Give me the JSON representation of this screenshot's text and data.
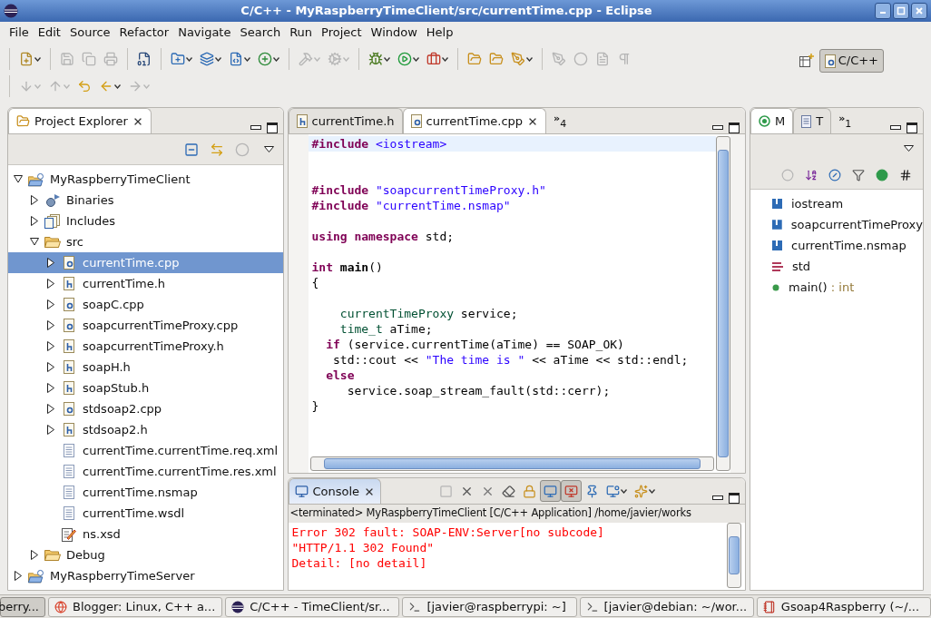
{
  "window": {
    "title": "C/C++ - MyRaspberryTimeClient/src/currentTime.cpp - Eclipse"
  },
  "menu": [
    "File",
    "Edit",
    "Source",
    "Refactor",
    "Navigate",
    "Search",
    "Run",
    "Project",
    "Window",
    "Help"
  ],
  "toolbar": {
    "rows": [
      [
        [
          {
            "kind": "new",
            "disabled": false,
            "dropdown": true
          }
        ],
        [
          {
            "kind": "save",
            "disabled": true,
            "dropdown": false
          },
          {
            "kind": "save-all",
            "disabled": true,
            "dropdown": false
          },
          {
            "kind": "print",
            "disabled": true,
            "dropdown": false
          }
        ],
        [
          {
            "kind": "binary",
            "disabled": false,
            "dropdown": false
          }
        ],
        [
          {
            "kind": "new-project",
            "disabled": false,
            "dropdown": true
          },
          {
            "kind": "new-folder",
            "disabled": false,
            "dropdown": true
          },
          {
            "kind": "new-class",
            "disabled": false,
            "dropdown": true
          },
          {
            "kind": "new-other",
            "disabled": false,
            "dropdown": true
          }
        ],
        [
          {
            "kind": "build",
            "disabled": true,
            "dropdown": true
          },
          {
            "kind": "build-all",
            "disabled": true,
            "dropdown": true
          }
        ],
        [
          {
            "kind": "debug",
            "disabled": false,
            "dropdown": true
          },
          {
            "kind": "run",
            "disabled": false,
            "dropdown": true
          },
          {
            "kind": "external",
            "disabled": false,
            "dropdown": true
          }
        ],
        [
          {
            "kind": "open-type",
            "disabled": false,
            "dropdown": false
          },
          {
            "kind": "open-element",
            "disabled": false,
            "dropdown": false
          },
          {
            "kind": "pen",
            "disabled": false,
            "dropdown": true
          }
        ],
        [
          {
            "kind": "pen",
            "disabled": true,
            "dropdown": false
          },
          {
            "kind": "dots",
            "disabled": true,
            "dropdown": false
          },
          {
            "kind": "page",
            "disabled": true,
            "dropdown": false
          },
          {
            "kind": "pilcrow",
            "disabled": true,
            "dropdown": false
          }
        ]
      ],
      [
        [
          {
            "kind": "next-annotation",
            "disabled": true,
            "dropdown": true
          },
          {
            "kind": "prev-annotation",
            "disabled": true,
            "dropdown": true
          },
          {
            "kind": "last-edit",
            "disabled": false,
            "dropdown": false
          },
          {
            "kind": "back",
            "disabled": false,
            "dropdown": true
          },
          {
            "kind": "forward",
            "disabled": true,
            "dropdown": true
          }
        ]
      ]
    ]
  },
  "perspectives": [
    {
      "label": "C/C++",
      "selected": true
    }
  ],
  "explorer": {
    "title": "Project Explorer",
    "actions": [
      {
        "kind": "collapse",
        "disabled": false
      },
      {
        "kind": "link",
        "disabled": false
      },
      {
        "kind": "dots",
        "disabled": true
      }
    ],
    "tree": [
      {
        "label": "MyRaspberryTimeClient",
        "kind": "project",
        "expanded": true,
        "selected": false,
        "children": [
          {
            "label": "Binaries",
            "kind": "binaries",
            "expanded": false,
            "selected": false
          },
          {
            "label": "Includes",
            "kind": "includes",
            "expanded": false,
            "selected": false
          },
          {
            "label": "src",
            "kind": "folder",
            "expanded": true,
            "selected": false,
            "children": [
              {
                "label": "currentTime.cpp",
                "kind": "c-source",
                "expanded": false,
                "selected": true
              },
              {
                "label": "currentTime.h",
                "kind": "header",
                "expanded": false,
                "selected": false
              },
              {
                "label": "soapC.cpp",
                "kind": "c-source",
                "expanded": false,
                "selected": false
              },
              {
                "label": "soapcurrentTimeProxy.cpp",
                "kind": "c-source",
                "expanded": false,
                "selected": false
              },
              {
                "label": "soapcurrentTimeProxy.h",
                "kind": "header",
                "expanded": false,
                "selected": false
              },
              {
                "label": "soapH.h",
                "kind": "header",
                "expanded": false,
                "selected": false
              },
              {
                "label": "soapStub.h",
                "kind": "header",
                "expanded": false,
                "selected": false
              },
              {
                "label": "stdsoap2.cpp",
                "kind": "c-source",
                "expanded": false,
                "selected": false
              },
              {
                "label": "stdsoap2.h",
                "kind": "header",
                "expanded": false,
                "selected": false
              },
              {
                "label": "currentTime.currentTime.req.xml",
                "kind": "text",
                "selected": false
              },
              {
                "label": "currentTime.currentTime.res.xml",
                "kind": "text",
                "selected": false
              },
              {
                "label": "currentTime.nsmap",
                "kind": "text",
                "selected": false
              },
              {
                "label": "currentTime.wsdl",
                "kind": "text",
                "selected": false
              },
              {
                "label": "ns.xsd",
                "kind": "xsd",
                "selected": false
              }
            ]
          },
          {
            "label": "Debug",
            "kind": "folder",
            "expanded": false,
            "selected": false
          }
        ]
      },
      {
        "label": "MyRaspberryTimeServer",
        "kind": "project",
        "expanded": false,
        "selected": false
      }
    ]
  },
  "editor": {
    "tabs": [
      {
        "label": "currentTime.h",
        "kind": "header",
        "selected": false
      },
      {
        "label": "currentTime.cpp",
        "kind": "c-source",
        "selected": true
      }
    ],
    "overflow": {
      "chevron": "»",
      "count": "4"
    },
    "lines": [
      {
        "current": true,
        "tokens": [
          {
            "kind": "directive",
            "text": "#include "
          },
          {
            "kind": "string",
            "text": "<iostream>"
          }
        ]
      },
      {
        "current": false
      },
      {
        "current": false
      },
      {
        "current": false,
        "tokens": [
          {
            "kind": "directive",
            "text": "#include "
          },
          {
            "kind": "string",
            "text": "\"soapcurrentTimeProxy.h\""
          }
        ]
      },
      {
        "current": false,
        "tokens": [
          {
            "kind": "directive",
            "text": "#include "
          },
          {
            "kind": "string",
            "text": "\"currentTime.nsmap\""
          }
        ]
      },
      {
        "current": false
      },
      {
        "current": false,
        "tokens": [
          {
            "kind": "keyword",
            "text": "using namespace"
          },
          {
            "kind": "plain",
            "text": " std;"
          }
        ]
      },
      {
        "current": false
      },
      {
        "current": false,
        "tokens": [
          {
            "kind": "keyword",
            "text": "int "
          },
          {
            "kind": "function",
            "text": "main"
          },
          {
            "kind": "plain",
            "text": "()"
          }
        ]
      },
      {
        "current": false,
        "tokens": [
          {
            "kind": "plain",
            "text": "{"
          }
        ]
      },
      {
        "current": false
      },
      {
        "current": false,
        "tokens": [
          {
            "kind": "type",
            "text": "    currentTimeProxy"
          },
          {
            "kind": "plain",
            "text": " service;"
          }
        ]
      },
      {
        "current": false,
        "tokens": [
          {
            "kind": "type",
            "text": "    time_t"
          },
          {
            "kind": "plain",
            "text": " aTime;"
          }
        ]
      },
      {
        "current": false,
        "tokens": [
          {
            "kind": "keyword",
            "text": "  if"
          },
          {
            "kind": "plain",
            "text": " (service.currentTime(aTime) == SOAP_OK)"
          }
        ]
      },
      {
        "current": false,
        "tokens": [
          {
            "kind": "plain",
            "text": "   std::cout << "
          },
          {
            "kind": "string",
            "text": "\"The time is \""
          },
          {
            "kind": "plain",
            "text": " << aTime << std::endl;"
          }
        ]
      },
      {
        "current": false,
        "tokens": [
          {
            "kind": "keyword",
            "text": "  else"
          }
        ]
      },
      {
        "current": false,
        "tokens": [
          {
            "kind": "plain",
            "text": "     service.soap_stream_fault(std::cerr);"
          }
        ]
      },
      {
        "current": false,
        "tokens": [
          {
            "kind": "plain",
            "text": "}"
          }
        ]
      }
    ]
  },
  "outline": {
    "tabs": [
      {
        "label": "M",
        "kind": "outline",
        "selected": true
      },
      {
        "label": "T",
        "kind": "tasks",
        "selected": false
      }
    ],
    "overflow": {
      "chevron": "»",
      "count": "1"
    },
    "actions": [
      {
        "kind": "dots",
        "disabled": true
      },
      {
        "kind": "sort",
        "disabled": false
      },
      {
        "kind": "hide-fields",
        "disabled": false
      },
      {
        "kind": "hide-static",
        "disabled": false
      },
      {
        "kind": "hide-nonpublic",
        "disabled": false
      },
      {
        "kind": "hash",
        "disabled": false
      }
    ],
    "items": [
      {
        "kind": "include",
        "label": "iostream"
      },
      {
        "kind": "include",
        "label": "soapcurrentTimeProxy"
      },
      {
        "kind": "include",
        "label": "currentTime.nsmap"
      },
      {
        "kind": "namespace",
        "label": "std"
      },
      {
        "kind": "function",
        "label": "main()",
        "return_type": ": int"
      }
    ]
  },
  "console": {
    "title": "Console",
    "actions": [
      {
        "kind": "stop",
        "disabled": true,
        "pressed": false,
        "dropdown": false
      },
      {
        "kind": "remove",
        "disabled": false,
        "pressed": false,
        "dropdown": false
      },
      {
        "kind": "remove-all",
        "disabled": false,
        "pressed": false,
        "dropdown": false
      },
      {
        "kind": "clear",
        "disabled": false,
        "pressed": false,
        "dropdown": false
      },
      {
        "kind": "scroll-lock",
        "disabled": false,
        "pressed": false,
        "dropdown": false
      },
      {
        "kind": "stdout",
        "disabled": false,
        "pressed": true,
        "dropdown": false
      },
      {
        "kind": "stderr",
        "disabled": false,
        "pressed": true,
        "dropdown": false
      },
      {
        "kind": "pin",
        "disabled": false,
        "pressed": false,
        "dropdown": false
      },
      {
        "kind": "display",
        "disabled": false,
        "pressed": false,
        "dropdown": true
      },
      {
        "kind": "open-console",
        "disabled": false,
        "pressed": false,
        "dropdown": true
      }
    ],
    "header": "<terminated> MyRaspberryTimeClient [C/C++ Application] /home/javier/works",
    "lines": [
      "Error 302 fault: SOAP-ENV:Server[no subcode]",
      "\"HTTP/1.1 302 Found\"",
      "Detail: [no detail]"
    ]
  },
  "taskbar": [
    {
      "label": "berry...",
      "kind": "none",
      "selected": true
    },
    {
      "label": "Blogger: Linux, C++ a...",
      "kind": "browser",
      "selected": false
    },
    {
      "label": "C/C++ - TimeClient/sr...",
      "kind": "eclipse",
      "selected": false
    },
    {
      "label": "[javier@raspberrypi: ~]",
      "kind": "terminal",
      "selected": false
    },
    {
      "label": "[javier@debian: ~/wor...",
      "kind": "terminal",
      "selected": false
    },
    {
      "label": "Gsoap4Raspberry (~/...",
      "kind": "notepad",
      "selected": false
    }
  ]
}
